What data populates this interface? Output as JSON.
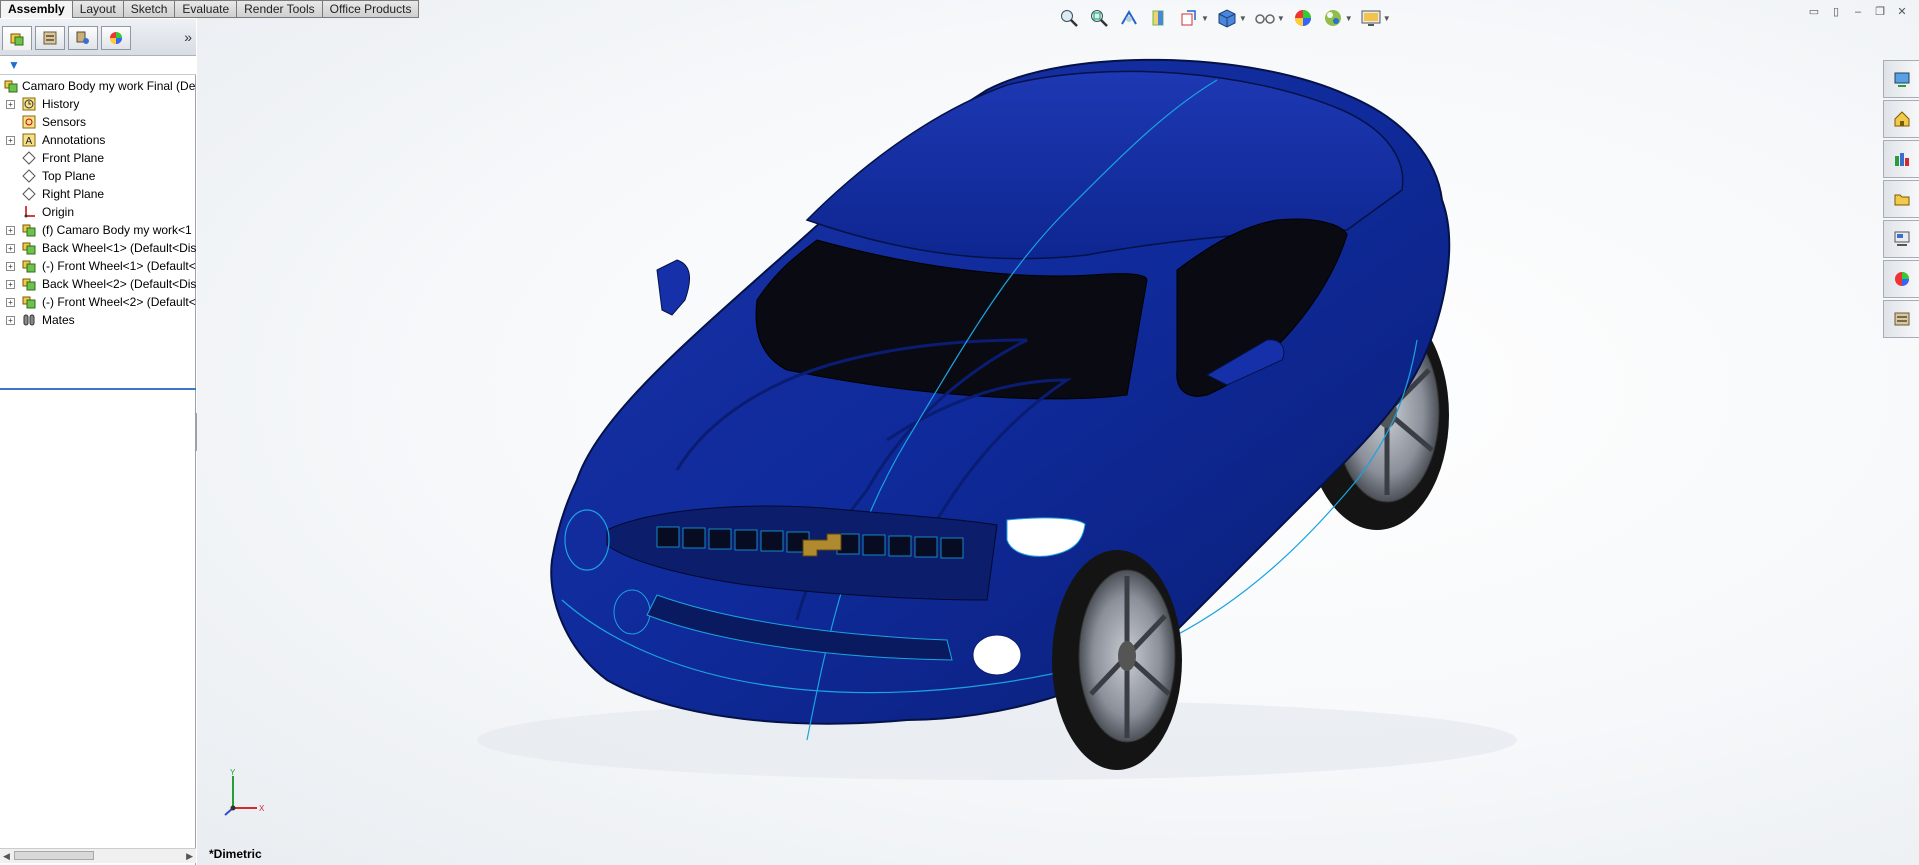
{
  "command_tabs": [
    "Assembly",
    "Layout",
    "Sketch",
    "Evaluate",
    "Render Tools",
    "Office Products"
  ],
  "feature_tree": {
    "root": "Camaro Body  my work Final  (De",
    "items": [
      {
        "label": "History",
        "icon": "history-icon",
        "expand": true
      },
      {
        "label": "Sensors",
        "icon": "sensor-icon",
        "expand": false
      },
      {
        "label": "Annotations",
        "icon": "annotation-icon",
        "expand": true
      },
      {
        "label": "Front Plane",
        "icon": "plane-icon",
        "expand": false
      },
      {
        "label": "Top Plane",
        "icon": "plane-icon",
        "expand": false
      },
      {
        "label": "Right Plane",
        "icon": "plane-icon",
        "expand": false
      },
      {
        "label": "Origin",
        "icon": "origin-icon",
        "expand": false
      },
      {
        "label": "(f) Camaro Body  my work<1",
        "icon": "part-icon",
        "expand": true
      },
      {
        "label": "Back Wheel<1> (Default<Dis",
        "icon": "part-icon",
        "expand": true
      },
      {
        "label": "(-) Front Wheel<1> (Default<",
        "icon": "part-icon",
        "expand": true
      },
      {
        "label": "Back Wheel<2> (Default<Dis",
        "icon": "part-icon",
        "expand": true
      },
      {
        "label": "(-) Front Wheel<2> (Default<",
        "icon": "part-icon",
        "expand": true
      },
      {
        "label": "Mates",
        "icon": "mates-icon",
        "expand": true
      }
    ]
  },
  "viewport": {
    "view_orientation": "*Dimetric",
    "triad": {
      "x": "X",
      "y": "Y"
    }
  },
  "colors": {
    "car_body": "#0f2a9a",
    "accent_line": "#1aa3e0",
    "glass": "#0a0a12"
  }
}
